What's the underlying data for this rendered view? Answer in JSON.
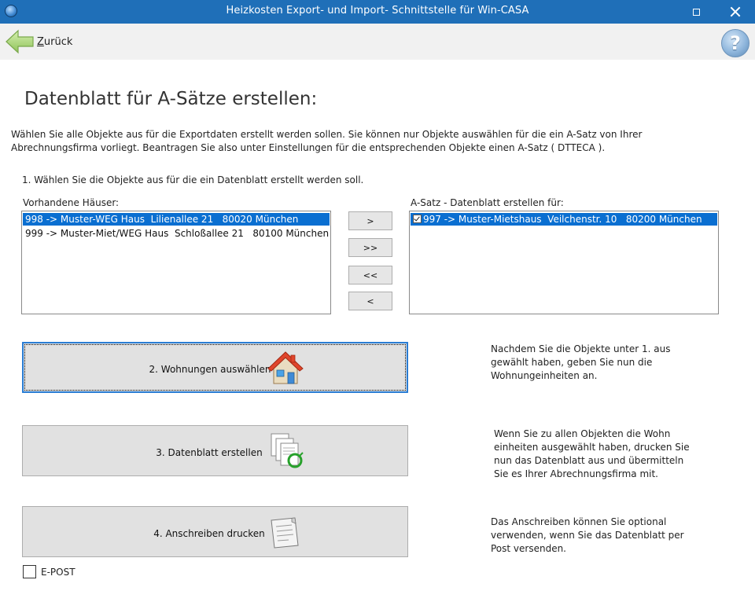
{
  "window": {
    "title": "Heizkosten Export- und Import- Schnittstelle für Win-CASA"
  },
  "toolbar": {
    "back_label_prefix": "Z",
    "back_label_rest": "urück",
    "help_glyph": "?"
  },
  "page": {
    "title": "Datenblatt für A-Sätze erstellen:",
    "intro_line1": "Wählen Sie alle Objekte aus für die Exportdaten erstellt werden sollen. Sie können nur Objekte auswählen für die ein A-Satz von Ihrer",
    "intro_line2": "Abrechnungsfirma vorliegt. Beantragen Sie also unter Einstellungen für die entsprechenden Objekte einen A-Satz ( DTTECA ).",
    "step1": "1. Wählen Sie die Objekte aus für die ein Datenblatt erstellt werden soll."
  },
  "left_list": {
    "label": "Vorhandene Häuser:",
    "items": [
      "998 -> Muster-WEG Haus  Lilienallee 21   80020 München",
      "999 -> Muster-Miet/WEG Haus  Schloßallee 21   80100 München"
    ],
    "selected_index": 0
  },
  "right_list": {
    "label": "A-Satz - Datenblatt erstellen für:",
    "items": [
      "997 -> Muster-Mietshaus  Veilchenstr. 10   80200 München"
    ],
    "checked": [
      true
    ]
  },
  "move_buttons": {
    "add_one": ">",
    "add_all": ">>",
    "remove_all": "<<",
    "remove_one": "<"
  },
  "steps": {
    "step2": {
      "label": "2. Wohnungen auswählen",
      "hint": [
        "Nachdem Sie die Objekte unter 1. aus",
        "gewählt haben, geben Sie nun die",
        "Wohnungeinheiten an."
      ]
    },
    "step3": {
      "label": "3. Datenblatt erstellen",
      "hint": [
        "Wenn Sie zu allen Objekten die Wohn",
        "einheiten ausgewählt haben, drucken  Sie",
        "nun das Datenblatt aus und übermitteln",
        "Sie es Ihrer Abrechnungsfirma mit."
      ]
    },
    "step4": {
      "label": "4. Anschreiben drucken",
      "hint": [
        "Das Anschreiben können Sie optional",
        "verwenden, wenn Sie das Datenblatt  per",
        "Post versenden."
      ]
    }
  },
  "epost": {
    "label": "E-POST",
    "checked": false
  },
  "colors": {
    "titlebar": "#1f6fb8",
    "selection": "#0a6fd1",
    "focus_border": "#2a7dd4"
  },
  "icons": {
    "app": "app-icon",
    "back": "back-arrow-icon",
    "help": "help-icon",
    "house": "house-icon",
    "documents": "documents-icon",
    "letter": "letter-icon"
  }
}
